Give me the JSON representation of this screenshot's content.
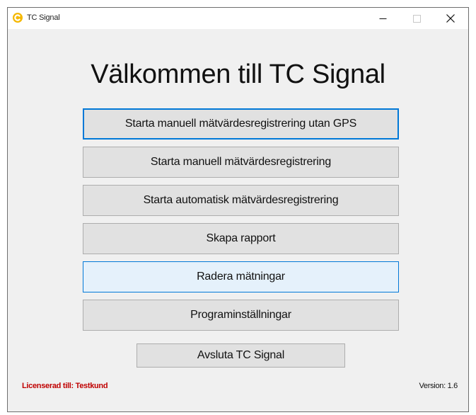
{
  "window": {
    "title": "TC Signal",
    "accent_color": "#0078d7",
    "icon": "tc-signal-app-icon"
  },
  "main": {
    "heading": "Välkommen till TC Signal",
    "buttons": [
      {
        "label": "Starta manuell mätvärdesregistrering utan GPS",
        "state": "focused"
      },
      {
        "label": "Starta manuell mätvärdesregistrering",
        "state": "normal"
      },
      {
        "label": "Starta automatisk mätvärdesregistrering",
        "state": "normal"
      },
      {
        "label": "Skapa rapport",
        "state": "normal"
      },
      {
        "label": "Radera mätningar",
        "state": "hover"
      },
      {
        "label": "Programinställningar",
        "state": "normal"
      }
    ],
    "exit_label": "Avsluta TC Signal"
  },
  "footer": {
    "license": "Licenserad till: Testkund",
    "license_color": "#c00000",
    "version": "Version: 1.6"
  }
}
